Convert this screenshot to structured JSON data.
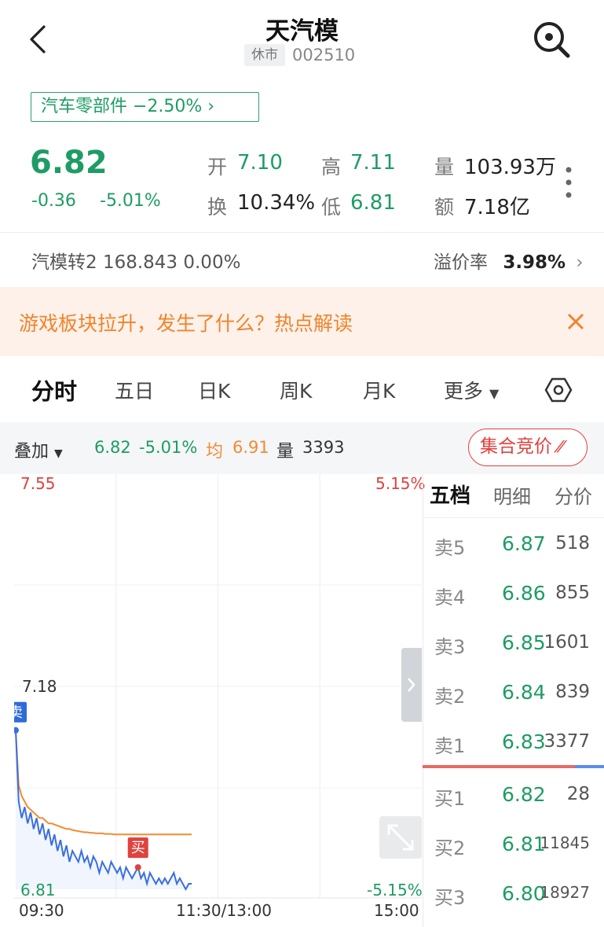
{
  "header": {
    "title": "天汽模",
    "status": "休市",
    "code": "002510"
  },
  "sector": {
    "label": "汽车零部件 −2.50%  ›"
  },
  "quote": {
    "price": "6.82",
    "change": "-0.36",
    "change_pct": "-5.01%",
    "open_label": "开",
    "open": "7.10",
    "high_label": "高",
    "high": "7.11",
    "volume_label": "量",
    "volume": "103.93万",
    "turnover_label": "换",
    "turnover": "10.34%",
    "low_label": "低",
    "low": "6.81",
    "amount_label": "额",
    "amount": "7.18亿"
  },
  "convertible": {
    "text": "汽模转2  168.843  0.00%",
    "premium_label": "溢价率",
    "premium_value": "3.98%",
    "chevron": "›"
  },
  "banner": {
    "text": "游戏板块拉升，发生了什么？热点解读"
  },
  "tabs": [
    "分时",
    "五日",
    "日K",
    "周K",
    "月K",
    "更多"
  ],
  "overlay": {
    "label": "叠加",
    "price": "6.82",
    "pct": "-5.01%",
    "avg_label": "均",
    "avg": "6.91",
    "vol_label": "量",
    "vol": "3393",
    "auction_button": "集合竞价"
  },
  "chart_data": {
    "type": "line",
    "y_max_label": "7.55",
    "y_mid_label": "7.18",
    "y_min_label": "6.81",
    "pct_max_label": "5.15%",
    "pct_min_label": "-5.15%",
    "ylim": [
      6.81,
      7.55
    ],
    "x_labels": [
      "09:30",
      "11:30/13:00",
      "15:00"
    ],
    "sell_marker": "卖",
    "buy_marker": "买",
    "series": [
      {
        "name": "价",
        "color": "#3a6fe0",
        "values": [
          7.1,
          6.97,
          6.94,
          6.96,
          6.93,
          6.95,
          6.92,
          6.94,
          6.91,
          6.93,
          6.9,
          6.92,
          6.89,
          6.91,
          6.88,
          6.9,
          6.87,
          6.89,
          6.86,
          6.88,
          6.87,
          6.86,
          6.88,
          6.86,
          6.87,
          6.85,
          6.87,
          6.86,
          6.84,
          6.86,
          6.85,
          6.84,
          6.86,
          6.85,
          6.84,
          6.85,
          6.83,
          6.85,
          6.84,
          6.83,
          6.84,
          6.85,
          6.83,
          6.84,
          6.82,
          6.84,
          6.83,
          6.82,
          6.83,
          6.82,
          6.83,
          6.82,
          6.83,
          6.84,
          6.82,
          6.83,
          6.82,
          6.81,
          6.82,
          6.82
        ]
      },
      {
        "name": "均",
        "color": "#f28b32",
        "values": [
          7.1,
          7.0,
          6.98,
          6.97,
          6.96,
          6.955,
          6.95,
          6.945,
          6.94,
          6.94,
          6.935,
          6.93,
          6.93,
          6.928,
          6.926,
          6.924,
          6.922,
          6.92,
          6.92,
          6.918,
          6.917,
          6.916,
          6.915,
          6.914,
          6.914,
          6.913,
          6.913,
          6.912,
          6.912,
          6.912,
          6.911,
          6.911,
          6.911,
          6.91,
          6.91,
          6.91,
          6.91,
          6.91,
          6.91,
          6.91,
          6.91,
          6.91,
          6.91,
          6.91,
          6.91,
          6.91,
          6.91,
          6.91,
          6.91,
          6.91,
          6.91,
          6.91,
          6.91,
          6.91,
          6.91,
          6.91,
          6.91,
          6.91,
          6.91,
          6.91
        ]
      }
    ]
  },
  "order_book": {
    "tabs": [
      "五档",
      "明细",
      "分价"
    ],
    "asks": [
      {
        "label": "卖5",
        "price": "6.87",
        "vol": "518"
      },
      {
        "label": "卖4",
        "price": "6.86",
        "vol": "855"
      },
      {
        "label": "卖3",
        "price": "6.85",
        "vol": "1601"
      },
      {
        "label": "卖2",
        "price": "6.84",
        "vol": "839"
      },
      {
        "label": "卖1",
        "price": "6.83",
        "vol": "3377"
      }
    ],
    "bids": [
      {
        "label": "买1",
        "price": "6.82",
        "vol": "28"
      },
      {
        "label": "买2",
        "price": "6.81",
        "vol": "11845"
      },
      {
        "label": "买3",
        "price": "6.80",
        "vol": "18927"
      }
    ]
  }
}
